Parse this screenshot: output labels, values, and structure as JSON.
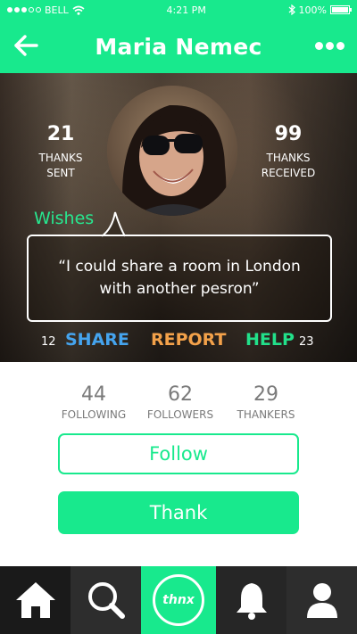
{
  "status_bar": {
    "carrier": "BELL",
    "time": "4:21 PM",
    "battery": "100%",
    "signal_bars": 3,
    "battery_level": 1.0
  },
  "nav": {
    "title": "Maria Nemec",
    "back_icon": "arrow-left-icon",
    "more_icon": "more-dots-icon"
  },
  "hero": {
    "thanks_sent": {
      "value": "21",
      "label_line1": "THANKS",
      "label_line2": "SENT"
    },
    "thanks_received": {
      "value": "99",
      "label_line1": "THANKS",
      "label_line2": "RECEIVED"
    },
    "wishes_label": "Wishes",
    "quote": "“I could share a room in London with another pesron”",
    "share_count": "12",
    "help_count": "23",
    "actions": {
      "share": "SHARE",
      "report": "REPORT",
      "help": "HELP"
    }
  },
  "profile_stats": [
    {
      "value": "44",
      "label": "FOLLOWING"
    },
    {
      "value": "62",
      "label": "FOLLOWERS"
    },
    {
      "value": "29",
      "label": "THANKERS"
    }
  ],
  "buttons": {
    "follow": "Follow",
    "thank": "Thank"
  },
  "tab_bar": {
    "tabs": [
      {
        "icon": "home-icon"
      },
      {
        "icon": "search-icon"
      },
      {
        "icon": "thnx-logo",
        "label": "thnx"
      },
      {
        "icon": "bell-icon"
      },
      {
        "icon": "user-icon"
      }
    ]
  },
  "colors": {
    "accent": "#18e98d",
    "share": "#45a4ee",
    "report": "#f3a14a",
    "help": "#22e08a",
    "tab_bar": "#262626"
  }
}
